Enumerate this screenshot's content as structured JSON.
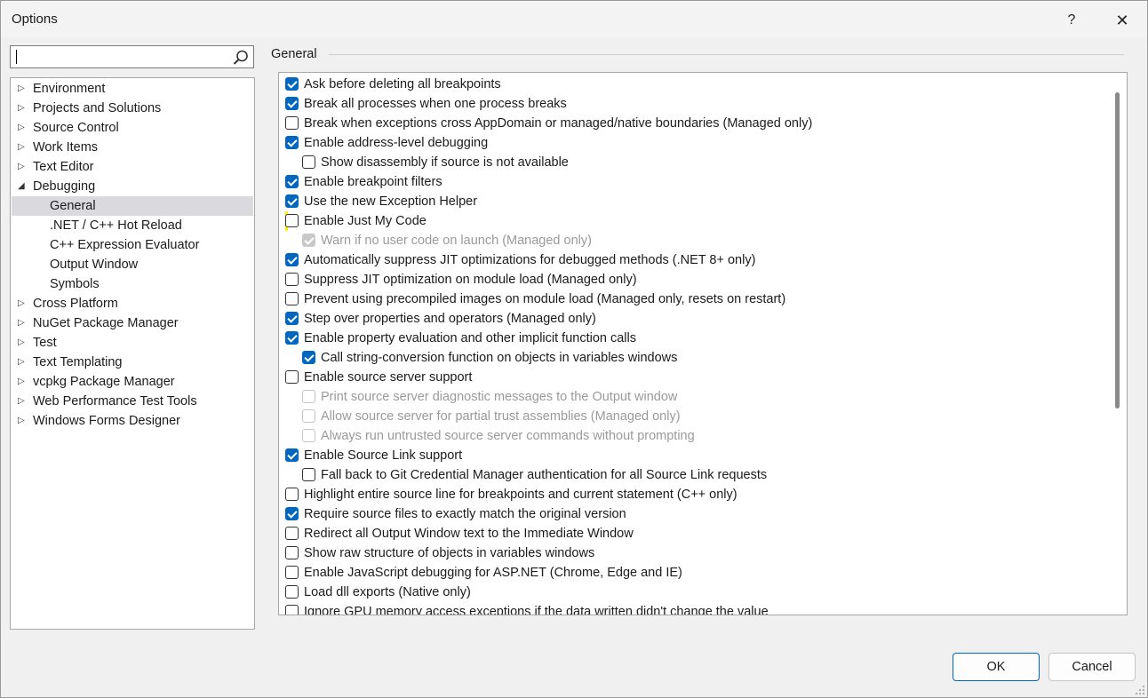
{
  "window": {
    "title": "Options",
    "help_glyph": "?",
    "close_glyph": "✕"
  },
  "search": {
    "value": ""
  },
  "tree": [
    {
      "label": "Environment",
      "level": 0,
      "arrow": "▷"
    },
    {
      "label": "Projects and Solutions",
      "level": 0,
      "arrow": "▷"
    },
    {
      "label": "Source Control",
      "level": 0,
      "arrow": "▷"
    },
    {
      "label": "Work Items",
      "level": 0,
      "arrow": "▷"
    },
    {
      "label": "Text Editor",
      "level": 0,
      "arrow": "▷"
    },
    {
      "label": "Debugging",
      "level": 0,
      "arrow": "◢"
    },
    {
      "label": "General",
      "level": 1,
      "arrow": "",
      "selected": true
    },
    {
      "label": ".NET / C++ Hot Reload",
      "level": 1,
      "arrow": ""
    },
    {
      "label": "C++ Expression Evaluator",
      "level": 1,
      "arrow": ""
    },
    {
      "label": "Output Window",
      "level": 1,
      "arrow": ""
    },
    {
      "label": "Symbols",
      "level": 1,
      "arrow": ""
    },
    {
      "label": "Cross Platform",
      "level": 0,
      "arrow": "▷"
    },
    {
      "label": "NuGet Package Manager",
      "level": 0,
      "arrow": "▷"
    },
    {
      "label": "Test",
      "level": 0,
      "arrow": "▷"
    },
    {
      "label": "Text Templating",
      "level": 0,
      "arrow": "▷"
    },
    {
      "label": "vcpkg Package Manager",
      "level": 0,
      "arrow": "▷"
    },
    {
      "label": "Web Performance Test Tools",
      "level": 0,
      "arrow": "▷"
    },
    {
      "label": "Windows Forms Designer",
      "level": 0,
      "arrow": "▷"
    }
  ],
  "section_title": "General",
  "options": [
    {
      "label": "Ask before deleting all breakpoints",
      "checked": true,
      "indent": 0,
      "enabled": true
    },
    {
      "label": "Break all processes when one process breaks",
      "checked": true,
      "indent": 0,
      "enabled": true
    },
    {
      "label": "Break when exceptions cross AppDomain or managed/native boundaries (Managed only)",
      "checked": false,
      "indent": 0,
      "enabled": true
    },
    {
      "label": "Enable address-level debugging",
      "checked": true,
      "indent": 0,
      "enabled": true
    },
    {
      "label": "Show disassembly if source is not available",
      "checked": false,
      "indent": 1,
      "enabled": true
    },
    {
      "label": "Enable breakpoint filters",
      "checked": true,
      "indent": 0,
      "enabled": true
    },
    {
      "label": "Use the new Exception Helper",
      "checked": true,
      "indent": 0,
      "enabled": true
    },
    {
      "label": "Enable Just My Code",
      "checked": false,
      "indent": 0,
      "enabled": true,
      "highlight": true
    },
    {
      "label": "Warn if no user code on launch (Managed only)",
      "checked": true,
      "indent": 1,
      "enabled": false
    },
    {
      "label": "Automatically suppress JIT optimizations for debugged methods (.NET 8+ only)",
      "checked": true,
      "indent": 0,
      "enabled": true
    },
    {
      "label": "Suppress JIT optimization on module load (Managed only)",
      "checked": false,
      "indent": 0,
      "enabled": true
    },
    {
      "label": "Prevent using precompiled images on module load (Managed only, resets on restart)",
      "checked": false,
      "indent": 0,
      "enabled": true
    },
    {
      "label": "Step over properties and operators (Managed only)",
      "checked": true,
      "indent": 0,
      "enabled": true
    },
    {
      "label": "Enable property evaluation and other implicit function calls",
      "checked": true,
      "indent": 0,
      "enabled": true
    },
    {
      "label": "Call string-conversion function on objects in variables windows",
      "checked": true,
      "indent": 1,
      "enabled": true
    },
    {
      "label": "Enable source server support",
      "checked": false,
      "indent": 0,
      "enabled": true
    },
    {
      "label": "Print source server diagnostic messages to the Output window",
      "checked": false,
      "indent": 1,
      "enabled": false
    },
    {
      "label": "Allow source server for partial trust assemblies (Managed only)",
      "checked": false,
      "indent": 1,
      "enabled": false
    },
    {
      "label": "Always run untrusted source server commands without prompting",
      "checked": false,
      "indent": 1,
      "enabled": false
    },
    {
      "label": "Enable Source Link support",
      "checked": true,
      "indent": 0,
      "enabled": true
    },
    {
      "label": "Fall back to Git Credential Manager authentication for all Source Link requests",
      "checked": false,
      "indent": 1,
      "enabled": true
    },
    {
      "label": "Highlight entire source line for breakpoints and current statement (C++ only)",
      "checked": false,
      "indent": 0,
      "enabled": true
    },
    {
      "label": "Require source files to exactly match the original version",
      "checked": true,
      "indent": 0,
      "enabled": true
    },
    {
      "label": "Redirect all Output Window text to the Immediate Window",
      "checked": false,
      "indent": 0,
      "enabled": true
    },
    {
      "label": "Show raw structure of objects in variables windows",
      "checked": false,
      "indent": 0,
      "enabled": true
    },
    {
      "label": "Enable JavaScript debugging for ASP.NET (Chrome, Edge and IE)",
      "checked": false,
      "indent": 0,
      "enabled": true
    },
    {
      "label": "Load dll exports (Native only)",
      "checked": false,
      "indent": 0,
      "enabled": true
    },
    {
      "label": "Ignore GPU memory access exceptions if the data written didn't change the value",
      "checked": false,
      "indent": 0,
      "enabled": true
    }
  ],
  "buttons": {
    "ok": "OK",
    "cancel": "Cancel"
  },
  "colors": {
    "accent": "#0067c0",
    "highlight": "#ffef00",
    "selected_row": "#d9d9de"
  }
}
